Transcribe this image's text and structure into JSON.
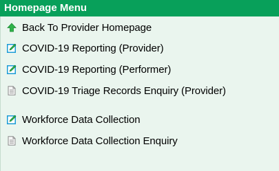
{
  "menu": {
    "title": "Homepage Menu",
    "items": [
      {
        "label": "Back To Provider Homepage",
        "icon": "arrow-up-icon"
      },
      {
        "label": "COVID-19 Reporting (Provider)",
        "icon": "edit-icon"
      },
      {
        "label": "COVID-19 Reporting (Performer)",
        "icon": "edit-icon"
      },
      {
        "label": "COVID-19 Triage Records Enquiry (Provider)",
        "icon": "document-icon"
      },
      {
        "label": "Workforce Data Collection",
        "icon": "edit-icon"
      },
      {
        "label": "Workforce Data Collection Enquiry",
        "icon": "document-icon"
      }
    ]
  },
  "colors": {
    "header_bg": "#08a05a",
    "body_bg": "#eaf5ee",
    "arrow": "#2fb34a",
    "edit_icon": "#1a9bd6"
  }
}
